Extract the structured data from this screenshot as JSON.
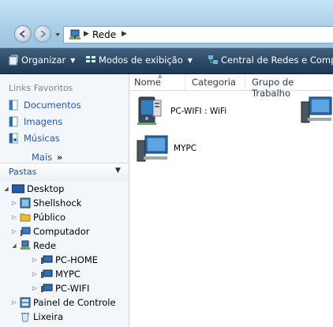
{
  "address": {
    "path": "Rede"
  },
  "toolbar": {
    "organize": "Organizar",
    "views": "Modos de exibição",
    "network_center": "Central de Redes e Compart"
  },
  "nav": {
    "favorites_header": "Links Favoritos",
    "favorites": [
      "Documentos",
      "Imagens",
      "Músicas"
    ],
    "more": "Mais",
    "folders_header": "Pastas",
    "tree": [
      "Desktop",
      "Shellshock",
      "Público",
      "Computador",
      "Rede",
      "PC-HOME",
      "MYPC",
      "PC-WIFI",
      "Painel de Controle",
      "Lixeira"
    ]
  },
  "columns": [
    "Nome",
    "Categoria",
    "Grupo de Trabalho"
  ],
  "items": [
    "PC-WIFI : WiFi",
    "MYPC"
  ],
  "colors": {
    "toolbar_bg": "#2c4a66",
    "link": "#1e5aa8",
    "nav_bg": "#f3f7fb"
  }
}
